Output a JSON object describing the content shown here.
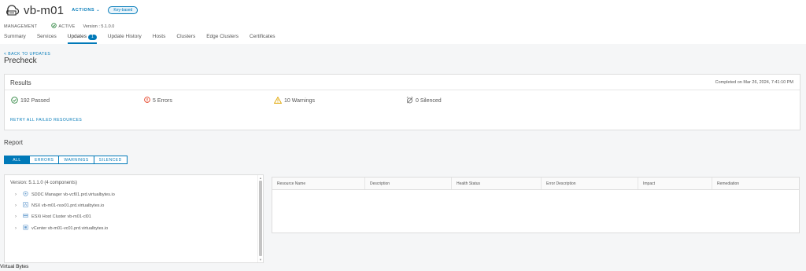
{
  "header": {
    "title": "vb-m01",
    "actions_label": "ACTIONS",
    "badge": "Key-based",
    "domain_type": "MANAGEMENT",
    "status": "ACTIVE",
    "version": "Version : 5.1.0.0"
  },
  "tabs": [
    {
      "label": "Summary"
    },
    {
      "label": "Services"
    },
    {
      "label": "Updates",
      "count": "1"
    },
    {
      "label": "Update History"
    },
    {
      "label": "Hosts"
    },
    {
      "label": "Clusters"
    },
    {
      "label": "Edge Clusters"
    },
    {
      "label": "Certificates"
    }
  ],
  "page": {
    "back_link": "< BACK TO UPDATES",
    "title": "Precheck"
  },
  "results": {
    "title": "Results",
    "completed": "Completed on Mar 26, 2024, 7:41:10 PM",
    "passed": "192 Passed",
    "errors": "5 Errors",
    "warnings": "10 Warnings",
    "silenced": "0 Silenced",
    "retry_label": "RETRY ALL FAILED RESOURCES"
  },
  "report": {
    "title": "Report",
    "filters": [
      "ALL",
      "ERRORS",
      "WARNINGS",
      "SILENCED"
    ],
    "tree_version": "Version: 5.1.1.0 (4 components)",
    "components": [
      "SDDC Manager vb-vcf01.prd.virtualbytes.io",
      "NSX vb-m01-nsx01.prd.virtualbytes.io",
      "ESXi Host Cluster vb-m01-cl01",
      "vCenter vb-m01-vc01.prd.virtualbytes.io"
    ],
    "columns": [
      "Resource Name",
      "Description",
      "Health Status",
      "Error Description",
      "Impact",
      "Remediation"
    ]
  },
  "footer": "Virtual Bytes",
  "colors": {
    "accent": "#0079b8",
    "success": "#2e8540",
    "error": "#e12200",
    "warning": "#e0a500"
  }
}
